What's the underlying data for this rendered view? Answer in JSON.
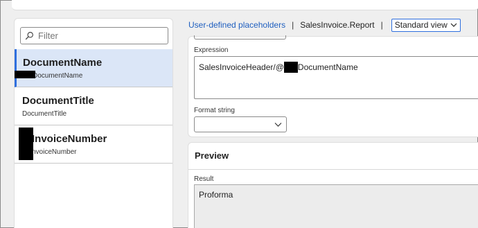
{
  "filter": {
    "placeholder": "Filter",
    "icon": "search-icon"
  },
  "list": [
    {
      "title": "DocumentName",
      "subtitle": "DocumentName",
      "selected": true
    },
    {
      "title": "DocumentTitle",
      "subtitle": "DocumentTitle",
      "selected": false
    },
    {
      "title": "InvoiceNumber",
      "subtitle": "nvoiceNumber",
      "selected": false
    }
  ],
  "header": {
    "link": "User-defined placeholders",
    "separator": "|",
    "crumb": "SalesInvoice.Report",
    "view": "Standard view"
  },
  "expression": {
    "label": "Expression",
    "value_prefix": "SalesInvoiceHeader/@",
    "value_suffix": "DocumentName"
  },
  "format_string": {
    "label": "Format string",
    "value": ""
  },
  "preview": {
    "title": "Preview",
    "result_label": "Result",
    "result_value": "Proforma"
  },
  "colors": {
    "accent": "#2f6fde",
    "link": "#1f5fbf",
    "selected_bg": "#dbe6f7"
  }
}
